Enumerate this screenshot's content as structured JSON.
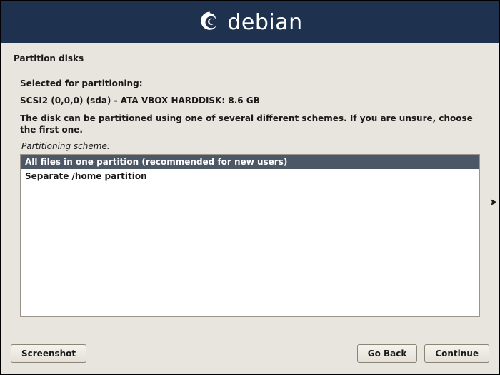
{
  "header": {
    "brand_text": "debian"
  },
  "page": {
    "title": "Partition disks"
  },
  "main": {
    "heading": "Selected for partitioning:",
    "disk_info": "SCSI2 (0,0,0) (sda) - ATA VBOX HARDDISK: 8.6 GB",
    "description": "The disk can be partitioned using one of several different schemes. If you are unsure, choose the first one.",
    "scheme_label": "Partitioning scheme:",
    "options": [
      {
        "label": "All files in one partition (recommended for new users)",
        "selected": true
      },
      {
        "label": "Separate /home partition",
        "selected": false
      }
    ]
  },
  "buttons": {
    "screenshot": "Screenshot",
    "goback": "Go Back",
    "continue": "Continue"
  }
}
